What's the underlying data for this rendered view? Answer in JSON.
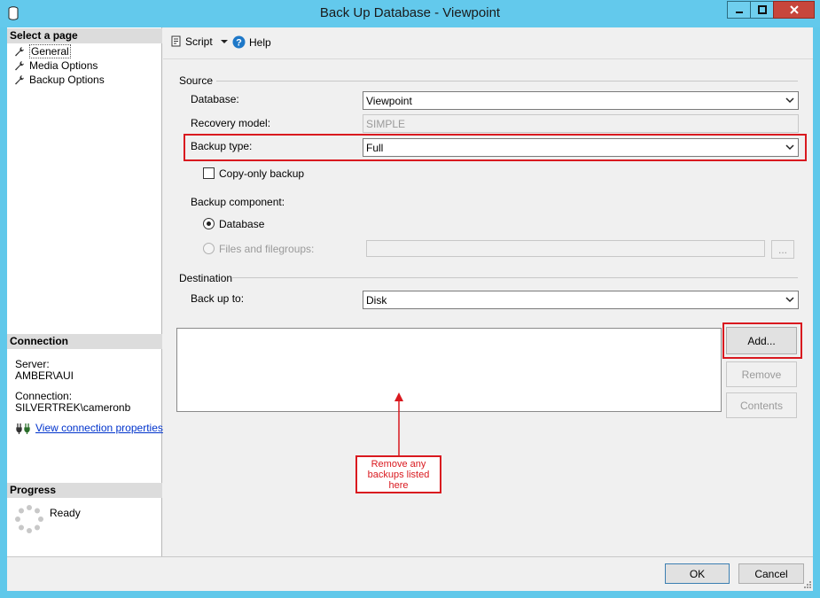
{
  "window": {
    "title": "Back Up Database - Viewpoint"
  },
  "left_pane": {
    "select_page_header": "Select a page",
    "pages": [
      {
        "label": "General"
      },
      {
        "label": "Media Options"
      },
      {
        "label": "Backup Options"
      }
    ],
    "connection_header": "Connection",
    "server_label": "Server:",
    "server_value": "AMBER\\AUI",
    "connection_label": "Connection:",
    "connection_value": "SILVERTREK\\cameronb",
    "view_connection_link": "View connection properties",
    "progress_header": "Progress",
    "progress_status": "Ready"
  },
  "toolbar": {
    "script_label": "Script",
    "help_label": "Help"
  },
  "source": {
    "group_label": "Source",
    "database_label": "Database:",
    "database_value": "Viewpoint",
    "recovery_model_label": "Recovery model:",
    "recovery_model_value": "SIMPLE",
    "backup_type_label": "Backup type:",
    "backup_type_value": "Full",
    "copy_only_label": "Copy-only backup",
    "backup_component_label": "Backup component:",
    "component_database_label": "Database",
    "component_files_label": "Files and filegroups:",
    "files_browse_label": "..."
  },
  "destination": {
    "group_label": "Destination",
    "back_up_to_label": "Back up to:",
    "back_up_to_value": "Disk",
    "add_button": "Add...",
    "remove_button": "Remove",
    "contents_button": "Contents"
  },
  "annotation": {
    "callout_text": "Remove any backups listed here",
    "color": "#d9191f"
  },
  "footer": {
    "ok_button": "OK",
    "cancel_button": "Cancel"
  },
  "colors": {
    "titlebar": "#63c9ec",
    "link": "#0033cc",
    "highlight": "#d9191f"
  }
}
